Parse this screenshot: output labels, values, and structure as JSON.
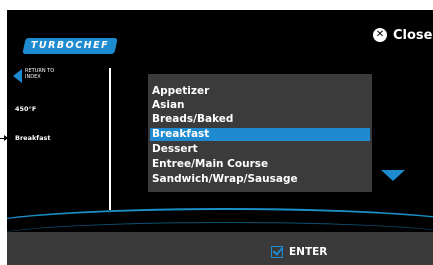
{
  "header": {
    "logo_text": "TURBOCHEF",
    "close_label": "Close"
  },
  "sidebar": {
    "back_label": "RETURN TO INDEX",
    "temperature": "450°F",
    "selected_category": "Breakfast"
  },
  "list": {
    "items": [
      "Appetizer",
      "Asian",
      "Breads/Baked",
      "Breakfast",
      "Dessert",
      "Entree/Main Course",
      "Sandwich/Wrap/Sausage"
    ],
    "selected_index": 3
  },
  "footer": {
    "enter_label": "ENTER"
  },
  "colors": {
    "accent": "#1e8ad0",
    "list_bg": "#3b3b3b",
    "footer_bg": "#3a3a3a"
  },
  "icons": [
    "close-icon",
    "back-arrow-icon",
    "scroll-down-icon",
    "check-icon",
    "pointer-arrow-icon"
  ]
}
